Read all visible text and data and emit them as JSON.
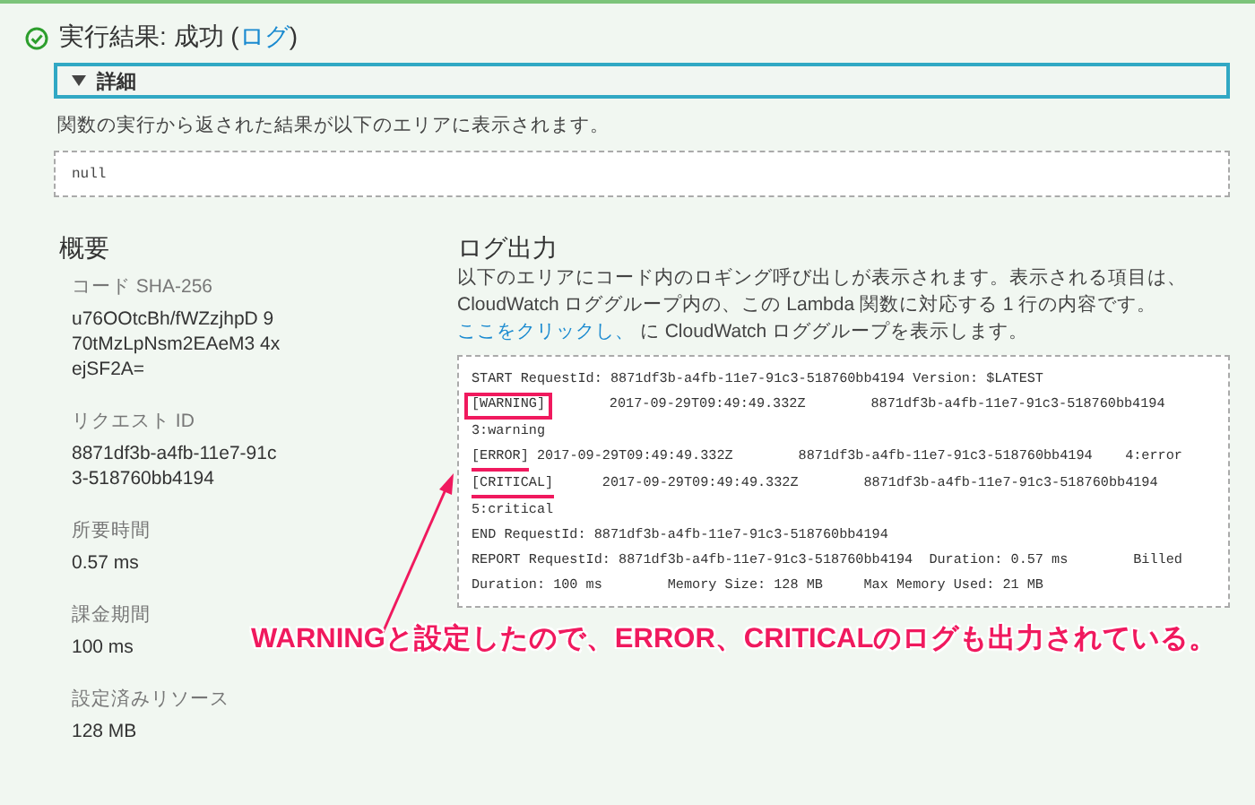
{
  "result": {
    "title_prefix": "実行結果: 成功 (",
    "link": "ログ",
    "title_suffix": ")"
  },
  "details": {
    "label": "詳細",
    "expanded": true
  },
  "result_description": "関数の実行から返された結果が以下のエリアに表示されます。",
  "result_value": "null",
  "summary": {
    "heading": "概要",
    "items": [
      {
        "label": "コード SHA-256",
        "value": "u76OOtcBh/fWZzjhpD 970tMzLpNsm2EAeM3 4xejSF2A="
      },
      {
        "label": "リクエスト ID",
        "value": "8871df3b-a4fb-11e7-91c3-518760bb4194"
      },
      {
        "label": "所要時間",
        "value": "0.57 ms"
      },
      {
        "label": "課金期間",
        "value": "100 ms"
      },
      {
        "label": "設定済みリソース",
        "value": "128 MB"
      }
    ]
  },
  "log_output": {
    "heading": "ログ出力",
    "description_prefix": "以下のエリアにコード内のロギング呼び出しが表示されます。表示される項目は、CloudWatch ロググループ内の、この Lambda 関数に対応する 1 行の内容です。",
    "link": "ここをクリックし、",
    "description_suffix": " に CloudWatch ロググループを表示します。",
    "lines": [
      {
        "text": "START RequestId: 8871df3b-a4fb-11e7-91c3-518760bb4194 Version: $LATEST"
      },
      {
        "tag": "[WARNING]",
        "kind": "box",
        "text": "       2017-09-29T09:49:49.332Z        8871df3b-a4fb-11e7-91c3-518760bb4194"
      },
      {
        "text": "3:warning"
      },
      {
        "tag": "[ERROR]",
        "kind": "underline",
        "text": " 2017-09-29T09:49:49.332Z        8871df3b-a4fb-11e7-91c3-518760bb4194    4:error"
      },
      {
        "tag": "[CRITICAL]",
        "kind": "underline",
        "text": "      2017-09-29T09:49:49.332Z        8871df3b-a4fb-11e7-91c3-518760bb4194"
      },
      {
        "text": "5:critical"
      },
      {
        "text": "END RequestId: 8871df3b-a4fb-11e7-91c3-518760bb4194"
      },
      {
        "text": "REPORT RequestId: 8871df3b-a4fb-11e7-91c3-518760bb4194  Duration: 0.57 ms        Billed"
      },
      {
        "text": "Duration: 100 ms        Memory Size: 128 MB     Max Memory Used: 21 MB"
      }
    ]
  },
  "annotation": "WARNINGと設定したので、ERROR、CRITICALのログも出力されている。"
}
